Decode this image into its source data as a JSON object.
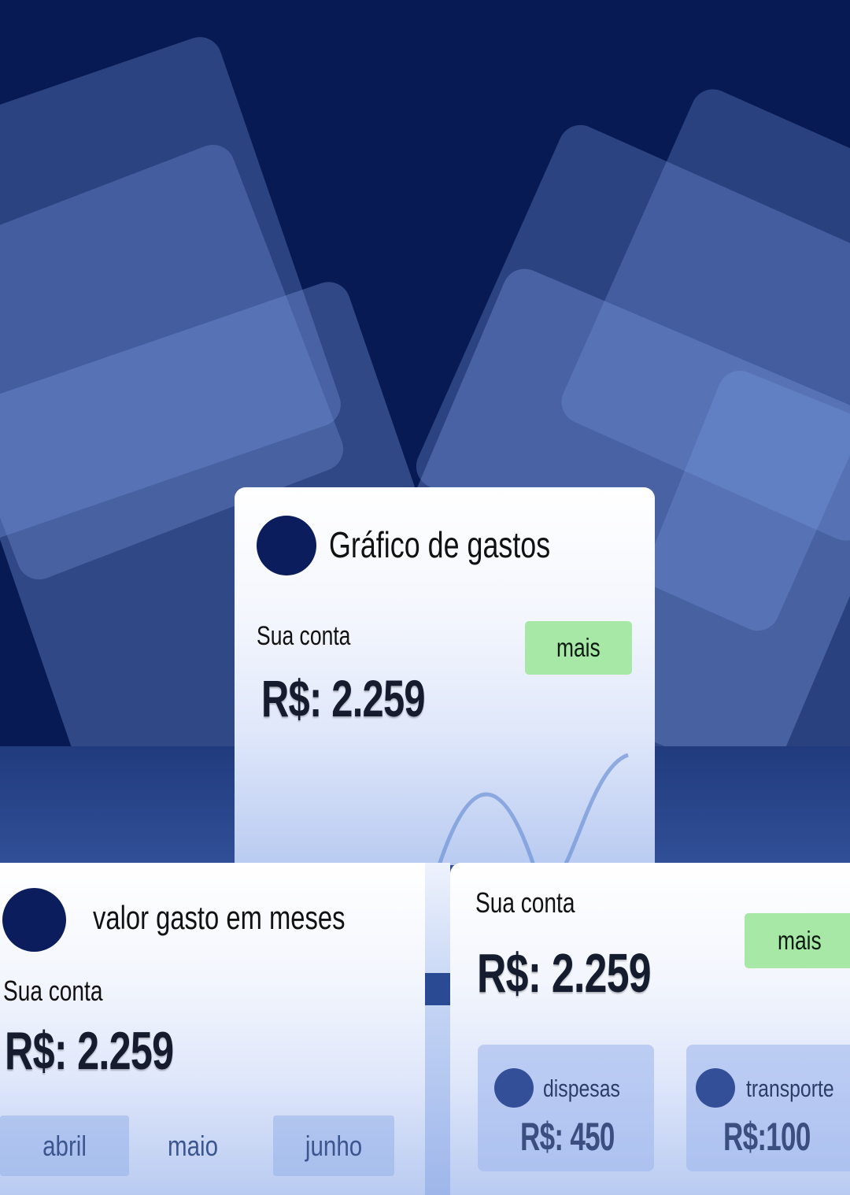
{
  "colors": {
    "background": "#071a54",
    "card_white": "#ffffff",
    "avatar": "#0b1d5c",
    "button_green": "#a8e8a6",
    "amount_text": "#141c2e",
    "tag_blue": "#96b0e8"
  },
  "main_card": {
    "title": "Gráfico de gastos",
    "account_label": "Sua conta",
    "amount": "R$: 2.259",
    "more_button": "mais"
  },
  "months_card": {
    "title": "valor gasto em meses",
    "account_label": "Sua conta",
    "amount": "R$: 2.259",
    "months": [
      "abril",
      "maio",
      "junho"
    ]
  },
  "category_card": {
    "account_label": "Sua conta",
    "amount": "R$: 2.259",
    "more_button": "mais",
    "categories": [
      {
        "label": "dispesas",
        "amount": "R$: 450"
      },
      {
        "label": "transporte",
        "amount": "R$:100"
      }
    ]
  }
}
